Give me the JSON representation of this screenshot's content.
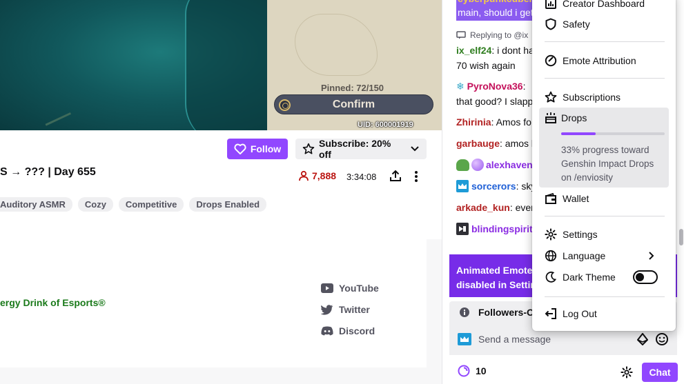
{
  "video": {
    "pinned": "Pinned: 72/150",
    "confirm": "Confirm",
    "uid": "UID: 600001919"
  },
  "stream": {
    "follow_label": "Follow",
    "subscribe_label": "Subscribe: 20% off",
    "title": "S → ??? | Day 655",
    "viewers": "7,888",
    "uptime": "3:34:08",
    "tags": [
      "Auditory ASMR",
      "Cozy",
      "Competitive",
      "Drops Enabled"
    ],
    "sponsor": "ergy Drink of Esports®",
    "socials": [
      "YouTube",
      "Twitter",
      "Discord"
    ]
  },
  "chat": {
    "highlight_line1": "cyberpunkcuber",
    "highlight_line2": "main, should i get",
    "replying": "Replying to @ix",
    "messages": [
      {
        "user": "ix_elf24",
        "color": "#2e7d1e",
        "text": ": i dont ha",
        "text2": "70 wish again"
      },
      {
        "user": "PyroNova36",
        "color": "#c4105a",
        "text": ":",
        "text2": "that good? I slapp"
      },
      {
        "user": "Zhirinia",
        "color": "#b22222",
        "text": ": Amos fo"
      },
      {
        "user": "garbauge",
        "color": "#b22222",
        "text": ": amos l"
      },
      {
        "user": "alexhaven",
        "color": "#8a2be2",
        "text": ""
      },
      {
        "user": "sorcerors",
        "color": "#1e5fd6",
        "text": ": sky"
      },
      {
        "user": "arkade_kun",
        "color": "#b22222",
        "text": ": ever"
      },
      {
        "user": "blindingspirit",
        "color": "#8a2be2",
        "text": ""
      }
    ],
    "emote_banner_1": "Animated Emotes",
    "emote_banner_2": "disabled in Setting",
    "followers_only": "Followers-O",
    "send_placeholder": "Send a message",
    "points": "10",
    "chat_button": "Chat"
  },
  "menu": {
    "creator_dashboard": "Creator Dashboard",
    "safety": "Safety",
    "emote_attribution": "Emote Attribution",
    "subscriptions": "Subscriptions",
    "drops": "Drops",
    "drops_progress": 0.33,
    "drops_desc": "33% progress toward Genshin Impact Drops on /enviosity",
    "wallet": "Wallet",
    "settings": "Settings",
    "language": "Language",
    "dark_theme": "Dark Theme",
    "dark_theme_on": false,
    "log_out": "Log Out"
  },
  "colors": {
    "accent": "#9147ff",
    "banner": "#772ce8",
    "live_red": "#bb1411",
    "sponsor_green": "#1a7a1a"
  }
}
